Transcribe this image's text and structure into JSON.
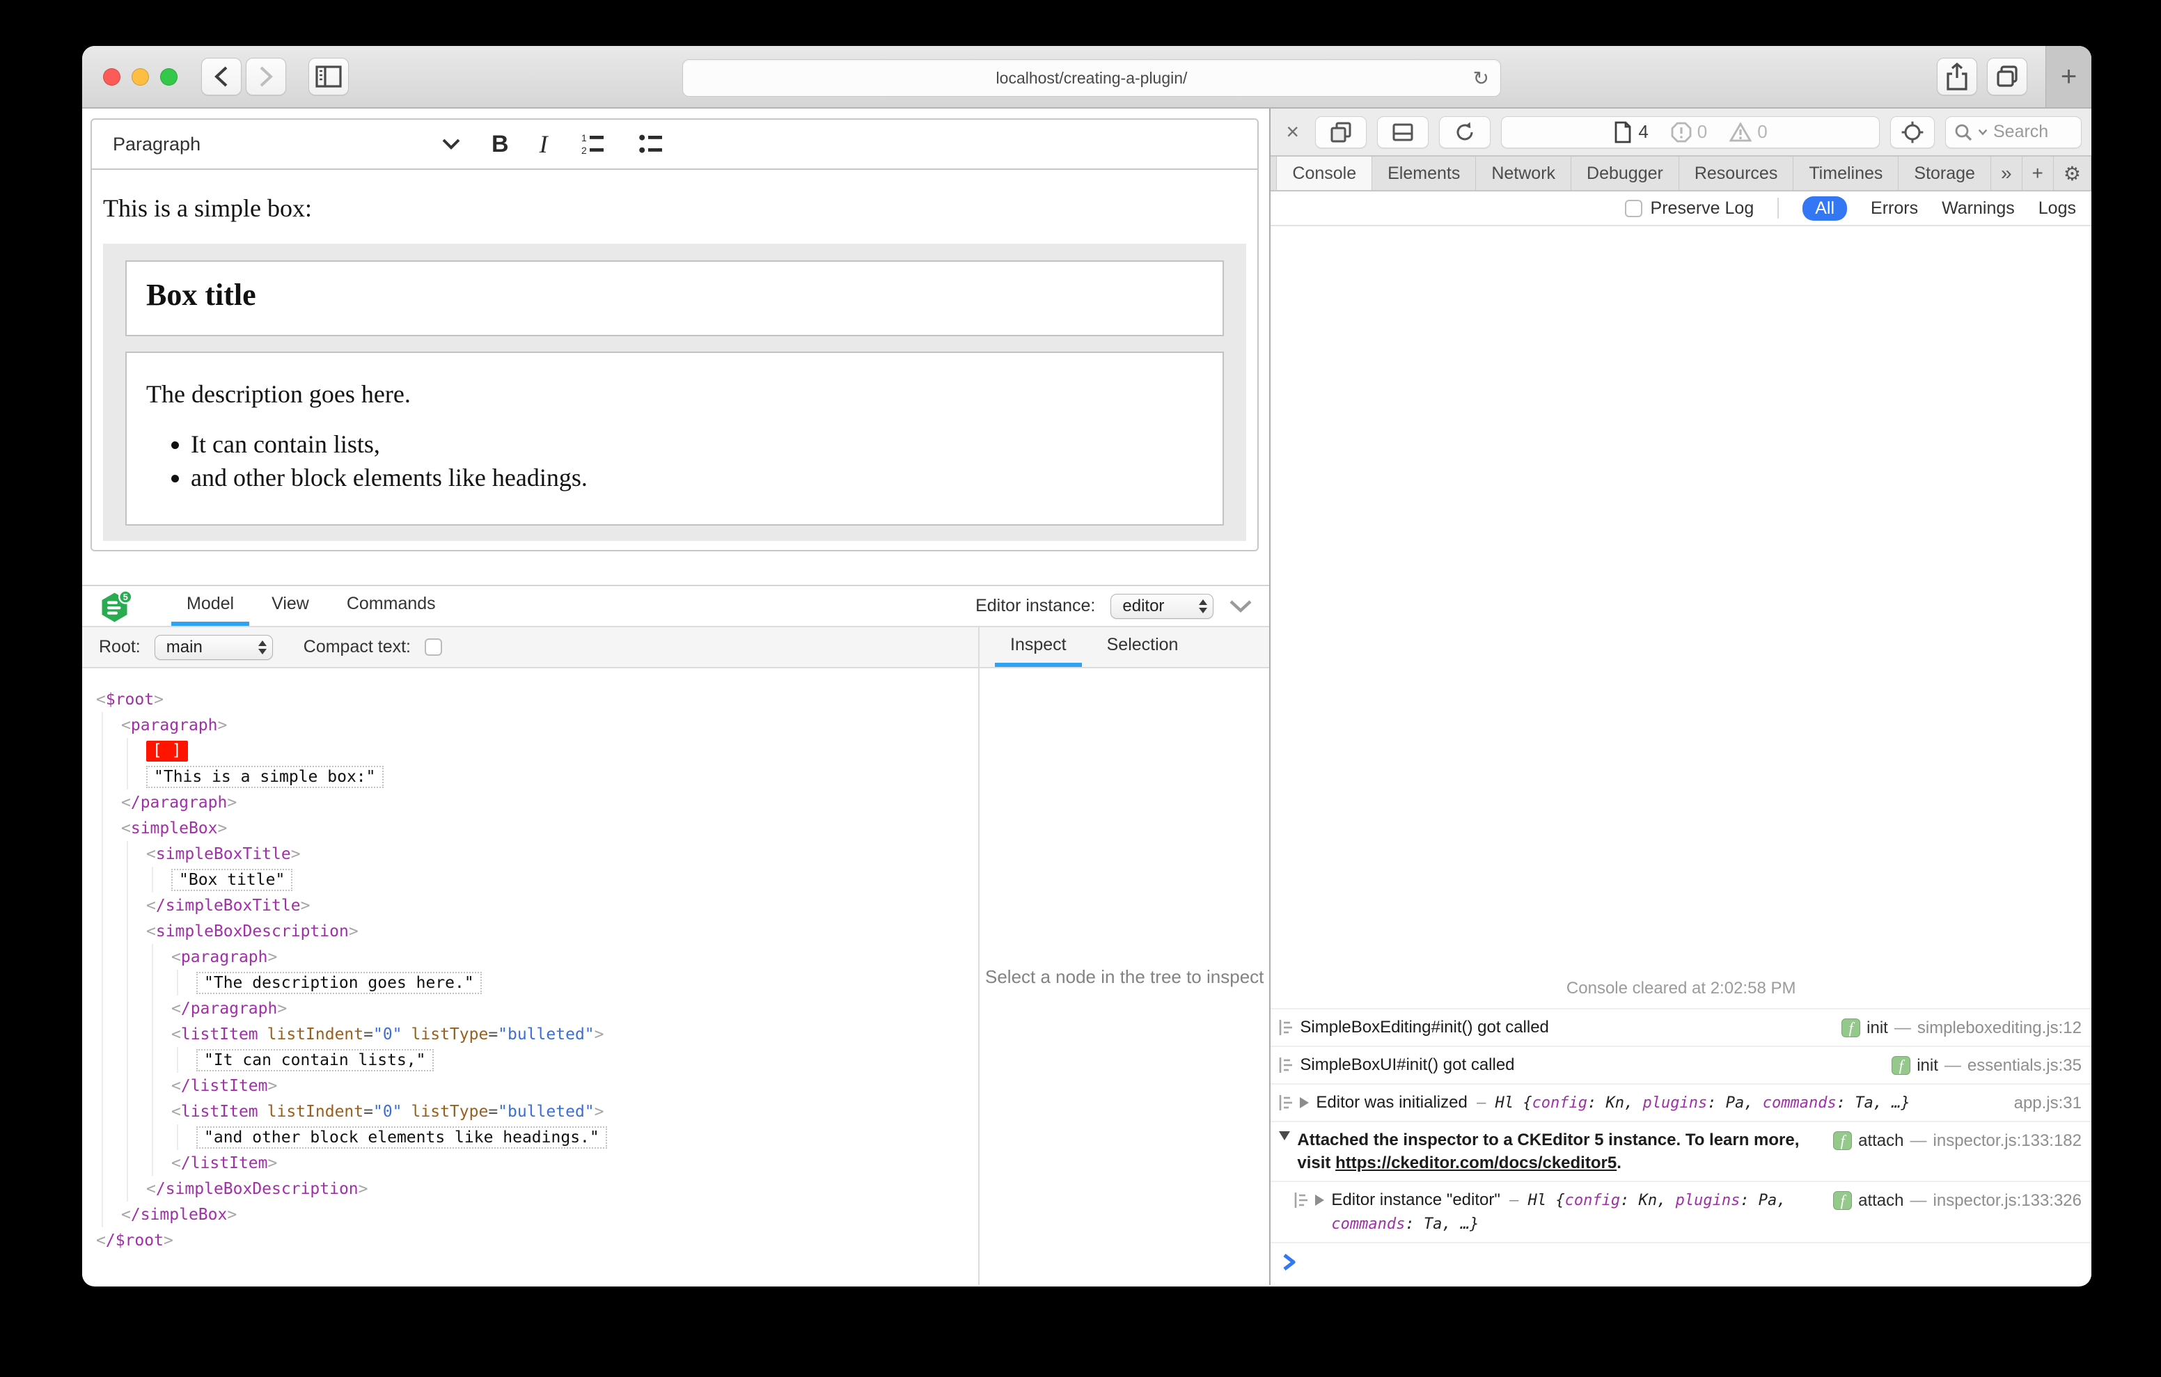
{
  "colors": {
    "accent_blue": "#3377f4",
    "underline_blue": "#2ea2f3",
    "mac_red": "#fc5b57",
    "mac_yellow": "#fdbe41",
    "mac_green": "#34c84a",
    "tag_purple": "#a12fa8",
    "attr_orange": "#9a5f1c",
    "value_blue": "#3a6fd8",
    "marker_red": "#ff1400",
    "badge_green": "#95c88b"
  },
  "browser": {
    "url": "localhost/creating-a-plugin/",
    "reload_glyph": "↻",
    "new_tab_label": "+"
  },
  "page": {
    "toolbar": {
      "paragraph_label": "Paragraph",
      "bold_label": "B",
      "italic_label": "I"
    },
    "content": {
      "intro": "This is a simple box:",
      "box_title": "Box title",
      "description": "The description goes here.",
      "list_items": [
        "It can contain lists,",
        "and other block elements like headings."
      ]
    }
  },
  "inspector": {
    "logo_badge": "5",
    "tabs": [
      "Model",
      "View",
      "Commands"
    ],
    "active_tab": "Model",
    "editor_instance_label": "Editor instance:",
    "editor_instance_value": "editor",
    "root_label": "Root:",
    "root_value": "main",
    "compact_text_label": "Compact text:",
    "side_tabs": [
      "Inspect",
      "Selection"
    ],
    "active_side_tab": "Inspect",
    "empty_message": "Select a node in the tree to inspect",
    "selection_marker": "[ ]",
    "tree": [
      {
        "indent": 0,
        "tag": "$root"
      },
      {
        "indent": 1,
        "tag": "paragraph"
      },
      {
        "indent": 2,
        "marker": true
      },
      {
        "indent": 2,
        "text": "\"This is a simple box:\""
      },
      {
        "indent": 1,
        "tag": "paragraph",
        "close": true
      },
      {
        "indent": 1,
        "tag": "simpleBox"
      },
      {
        "indent": 2,
        "tag": "simpleBoxTitle"
      },
      {
        "indent": 3,
        "text": "\"Box title\""
      },
      {
        "indent": 2,
        "tag": "simpleBoxTitle",
        "close": true
      },
      {
        "indent": 2,
        "tag": "simpleBoxDescription"
      },
      {
        "indent": 3,
        "tag": "paragraph"
      },
      {
        "indent": 4,
        "text": "\"The description goes here.\""
      },
      {
        "indent": 3,
        "tag": "paragraph",
        "close": true
      },
      {
        "indent": 3,
        "tag": "listItem",
        "attrs": [
          {
            "name": "listIndent",
            "value": "0"
          },
          {
            "name": "listType",
            "value": "bulleted"
          }
        ]
      },
      {
        "indent": 4,
        "text": "\"It can contain lists,\""
      },
      {
        "indent": 3,
        "tag": "listItem",
        "close": true
      },
      {
        "indent": 3,
        "tag": "listItem",
        "attrs": [
          {
            "name": "listIndent",
            "value": "0"
          },
          {
            "name": "listType",
            "value": "bulleted"
          }
        ]
      },
      {
        "indent": 4,
        "text": "\"and other block elements like headings.\""
      },
      {
        "indent": 3,
        "tag": "listItem",
        "close": true
      },
      {
        "indent": 2,
        "tag": "simpleBoxDescription",
        "close": true
      },
      {
        "indent": 1,
        "tag": "simpleBox",
        "close": true
      },
      {
        "indent": 0,
        "tag": "$root",
        "close": true
      }
    ]
  },
  "devtools": {
    "close_glyph": "×",
    "resource_count": "4",
    "error_count": "0",
    "warning_count": "0",
    "search_placeholder": "Search",
    "tabs": [
      "Console",
      "Elements",
      "Network",
      "Debugger",
      "Resources",
      "Timelines",
      "Storage"
    ],
    "active_tab": "Console",
    "overflow_label": "»",
    "add_label": "+",
    "settings_glyph": "⚙",
    "preserve_log_label": "Preserve Log",
    "filters": [
      "All",
      "Errors",
      "Warnings",
      "Logs"
    ],
    "active_filter": "All",
    "console": {
      "cleared_message": "Console cleared at 2:02:58 PM",
      "messages": [
        {
          "log_icon": true,
          "text": "SimpleBoxEditing#init() got called",
          "badge": "init",
          "location": "simpleboxediting.js:12"
        },
        {
          "log_icon": true,
          "text": "SimpleBoxUI#init() got called",
          "badge": "init",
          "location": "essentials.js:35"
        },
        {
          "log_icon": true,
          "disclosure": "closed",
          "text": "Editor was initialized",
          "preview": {
            "class_name": "Hl",
            "pairs": [
              {
                "key": "config",
                "value": "Kn"
              },
              {
                "key": "plugins",
                "value": "Pa"
              },
              {
                "key": "commands",
                "value": "Ta"
              }
            ],
            "ellipsis": "…}"
          },
          "location": "app.js:31"
        },
        {
          "disclosure": "open",
          "bold": true,
          "text": "Attached the inspector to a CKEditor 5 instance. To learn more, visit",
          "link": "https://ckeditor.com/docs/ckeditor5",
          "link_suffix": ".",
          "badge": "attach",
          "location": "inspector.js:133:182"
        },
        {
          "log_icon": true,
          "nested": true,
          "disclosure": "closed",
          "text": "Editor instance \"editor\"",
          "preview": {
            "class_name": "Hl",
            "pairs": [
              {
                "key": "config",
                "value": "Kn"
              },
              {
                "key": "plugins",
                "value": "Pa"
              },
              {
                "key": "commands",
                "value": "Ta"
              }
            ],
            "ellipsis": "…}"
          },
          "badge": "attach",
          "location": "inspector.js:133:326"
        }
      ]
    }
  }
}
